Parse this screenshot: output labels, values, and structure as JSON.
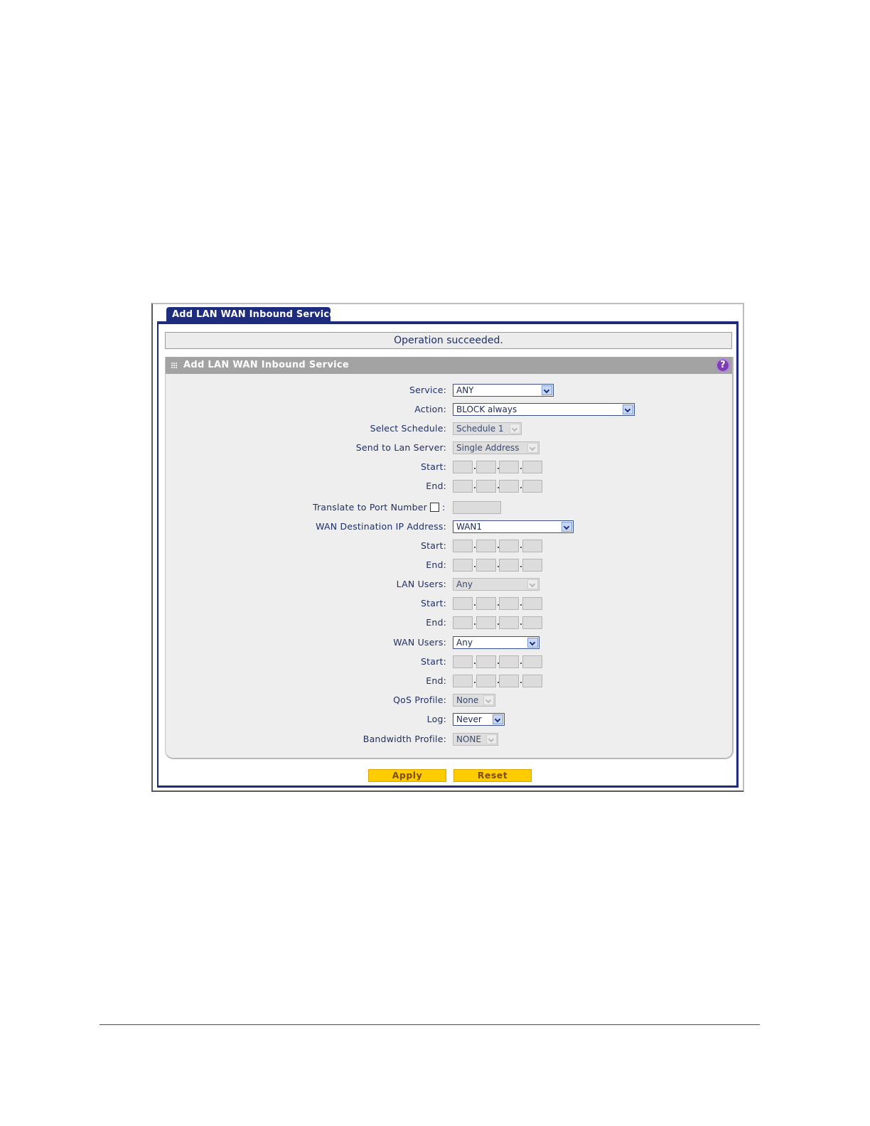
{
  "tab": {
    "label": "Add LAN WAN Inbound Service"
  },
  "status": {
    "message": "Operation succeeded."
  },
  "section": {
    "title": "Add LAN WAN Inbound Service",
    "help_icon": "?"
  },
  "form": {
    "service": {
      "label": "Service:",
      "value": "ANY"
    },
    "action": {
      "label": "Action:",
      "value": "BLOCK always"
    },
    "schedule": {
      "label": "Select Schedule:",
      "value": "Schedule 1"
    },
    "lan_server": {
      "label": "Send to Lan Server:",
      "value": "Single Address"
    },
    "lan_server_start": {
      "label": "Start:"
    },
    "lan_server_end": {
      "label": "End:"
    },
    "translate_port": {
      "label": "Translate to Port Number",
      "colon": ":"
    },
    "wan_dest": {
      "label": "WAN Destination IP Address:",
      "value": "WAN1"
    },
    "wan_dest_start": {
      "label": "Start:"
    },
    "wan_dest_end": {
      "label": "End:"
    },
    "lan_users": {
      "label": "LAN Users:",
      "value": "Any"
    },
    "lan_users_start": {
      "label": "Start:"
    },
    "lan_users_end": {
      "label": "End:"
    },
    "wan_users": {
      "label": "WAN Users:",
      "value": "Any"
    },
    "wan_users_start": {
      "label": "Start:"
    },
    "wan_users_end": {
      "label": "End:"
    },
    "qos": {
      "label": "QoS Profile:",
      "value": "None"
    },
    "log": {
      "label": "Log:",
      "value": "Never"
    },
    "bandwidth": {
      "label": "Bandwidth Profile:",
      "value": "NONE"
    }
  },
  "buttons": {
    "apply": "Apply",
    "reset": "Reset"
  }
}
